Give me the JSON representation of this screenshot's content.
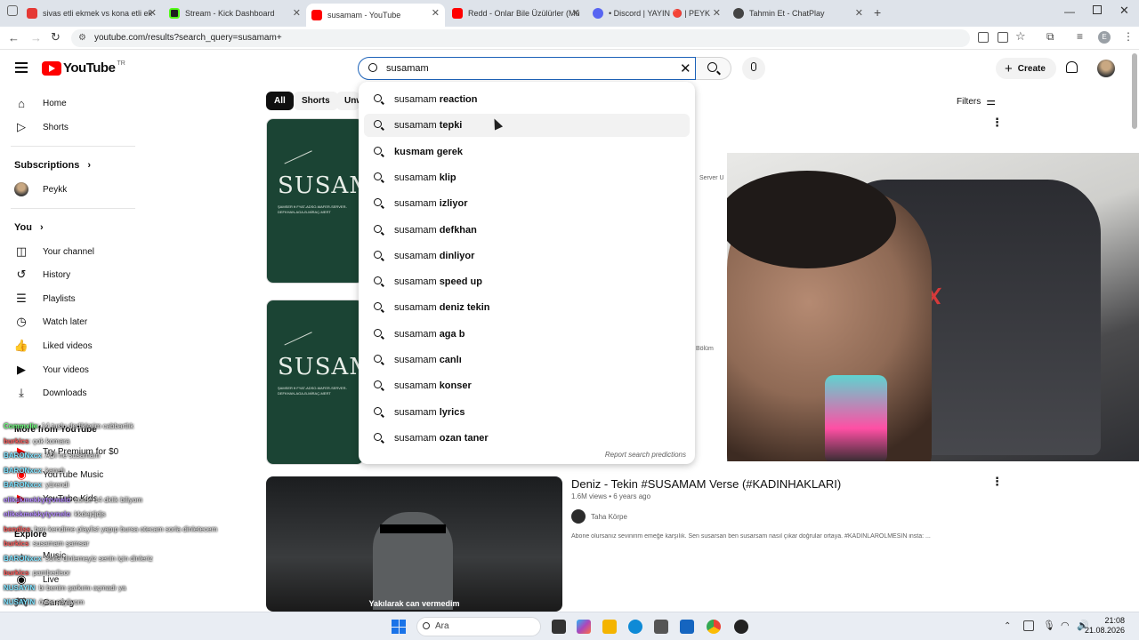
{
  "browser": {
    "tabs": [
      {
        "title": "sivas etli ekmek vs kona etli ek",
        "color": "#e53935"
      },
      {
        "title": "Stream - Kick Dashboard",
        "color": "#1f1f1f"
      },
      {
        "title": "susamam - YouTube",
        "color": "#ff0000"
      },
      {
        "title": "Redd - Onlar Bile Üzülürler (Mü",
        "color": "#ff0000"
      },
      {
        "title": "• Discord | YAYIN 🔴 | PEYK",
        "color": "#5865f2"
      },
      {
        "title": "Tahmin Et - ChatPlay",
        "color": "#444444"
      }
    ],
    "url": "youtube.com/results?search_query=susamam+",
    "profile_initial": "E"
  },
  "header": {
    "logo_text": "YouTube",
    "logo_region": "TR",
    "search_value": "susamam",
    "create_label": "Create"
  },
  "guide": {
    "main": [
      {
        "label": "Home",
        "icon": "home-icon"
      },
      {
        "label": "Shorts",
        "icon": "shorts-icon"
      }
    ],
    "subscriptions_title": "Subscriptions",
    "subscriptions": [
      {
        "label": "Peykk"
      }
    ],
    "you_title": "You",
    "you": [
      {
        "label": "Your channel",
        "icon": "channel-icon"
      },
      {
        "label": "History",
        "icon": "history-icon"
      },
      {
        "label": "Playlists",
        "icon": "playlists-icon"
      },
      {
        "label": "Watch later",
        "icon": "clock-icon"
      },
      {
        "label": "Liked videos",
        "icon": "like-icon"
      },
      {
        "label": "Your videos",
        "icon": "video-icon"
      },
      {
        "label": "Downloads",
        "icon": "download-icon"
      }
    ],
    "more_title": "More from YouTube",
    "more": [
      {
        "label": "Try Premium for $0"
      },
      {
        "label": "YouTube Music"
      },
      {
        "label": "YouTube Kids"
      }
    ],
    "explore_title": "Explore",
    "explore": [
      {
        "label": "Music"
      },
      {
        "label": "Live"
      },
      {
        "label": "Gaming"
      }
    ]
  },
  "chips": [
    "All",
    "Shorts",
    "Unw"
  ],
  "filters_label": "Filters",
  "suggestions": [
    {
      "prefix": "susamam",
      "suffix": "reaction"
    },
    {
      "prefix": "susamam",
      "suffix": "tepki"
    },
    {
      "prefix": "",
      "suffix": "kusmam gerek"
    },
    {
      "prefix": "susamam",
      "suffix": "klip"
    },
    {
      "prefix": "susamam",
      "suffix": "izliyor"
    },
    {
      "prefix": "susamam",
      "suffix": "defkhan"
    },
    {
      "prefix": "susamam",
      "suffix": "dinliyor"
    },
    {
      "prefix": "susamam",
      "suffix": "speed up"
    },
    {
      "prefix": "susamam",
      "suffix": "deniz tekin"
    },
    {
      "prefix": "susamam",
      "suffix": "aga b"
    },
    {
      "prefix": "susamam",
      "suffix": "canlı"
    },
    {
      "prefix": "susamam",
      "suffix": "konser"
    },
    {
      "prefix": "susamam",
      "suffix": "lyrics"
    },
    {
      "prefix": "susamam",
      "suffix": "ozan taner"
    }
  ],
  "report_label": "Report search predictions",
  "results": [
    {
      "thumb_title": "SUSAMAM",
      "thumb_sub": "ŞAMSER ft FYAT-ADSO-MAFER-SERVER-DEFKHAN-AGA-B-MİRAÇ-MERT",
      "side_text": "Server U"
    },
    {
      "thumb_title": "SUSAMAM",
      "thumb_sub": "ŞAMSER ft FYAT-ADSO-MAFER-SERVER-DEFKHAN-AGA-B-MİRAÇ-MERT",
      "side_text": "Tüm Bölüm"
    },
    {
      "title": "Deniz - Tekin #SUSAMAM Verse (#KADINHAKLARI)",
      "meta": "1.6M views • 6 years ago",
      "channel": "Taha Körpe",
      "desc": "Abone olursanız sevinirim emeğe karşılık. Sen susarsan ben susarsam nasıl çıkar doğrular ortaya. #KADINLARÖLMESİN insta: ...",
      "caption": "Yakılarak can vermedim"
    }
  ],
  "chat": [
    {
      "user": "Commxlie",
      "msg": ": 14 tuşlu dediklerim cabbartlık"
    },
    {
      "user": "burkics",
      "msg": ": çok komara"
    },
    {
      "user": "BARONxcx",
      "msg": ": ADI ne susamam"
    },
    {
      "user": "BARONxcx",
      "msg": ": kanıdı"
    },
    {
      "user": "BARONxcx",
      "msg": ": yürendi"
    },
    {
      "user": "elikskmekkytyvnelo",
      "msg": ": zorde 14 dklik biliyom"
    },
    {
      "user": "elikskmekkytyvnelo",
      "msg": ": kkdejdjdjs"
    },
    {
      "user": "bendiss",
      "msg": ": ben kendime playlist yapıp bursa otecam sorla dinletecem"
    },
    {
      "user": "burkics",
      "msg": ": susamam şamsar"
    },
    {
      "user": "BARONxcx",
      "msg": ": sorla dinlemeyiz senin için dinleriz"
    },
    {
      "user": "burkics",
      "msg": ": pamhedisor"
    },
    {
      "user": "NUSAYIN",
      "msg": ": bi benim şarkımı açmadı ya"
    },
    {
      "user": "NUSAYIN",
      "msg": ": öyler söyliyom"
    },
    {
      "user": "NUSAYIN",
      "msg": ": kn"
    },
    {
      "user": "gamerolay",
      "msg": ": şarkılar ne zaman"
    }
  ],
  "taskbar": {
    "search_label": "Ara",
    "time": "21:08",
    "date": "21.08.2026"
  },
  "colors": {
    "yt_red": "#ff0000",
    "thumb_green": "#1b4434",
    "chat_user_red": "#ff5a5a",
    "chat_user_green": "#6cff7c"
  }
}
